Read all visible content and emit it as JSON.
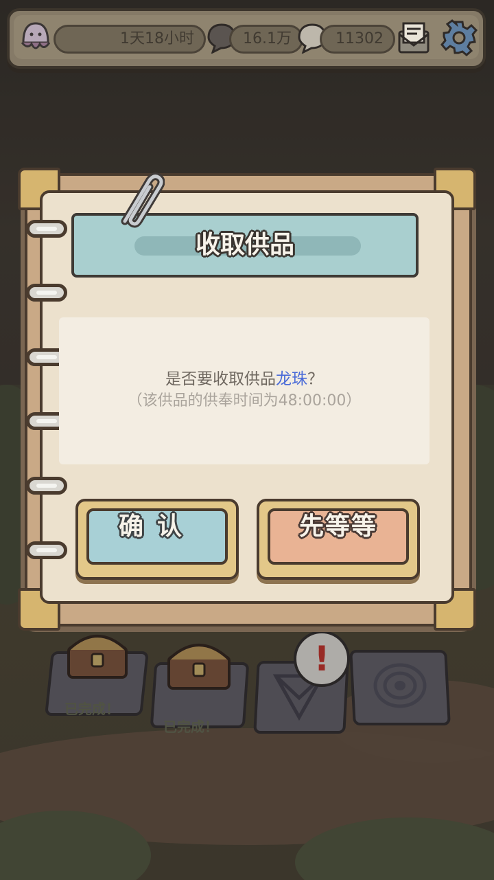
{
  "topbar": {
    "time_remaining": "1天18小时",
    "currency_1": "16.1万",
    "currency_2": "11302",
    "icons": [
      "jellyfish-avatar-icon",
      "speech-bubble-icon",
      "speech-bubble-icon",
      "mail-icon",
      "gear-icon"
    ]
  },
  "dialog": {
    "title": "收取供品",
    "question_prefix": "是否要收取供品",
    "item_name": "龙珠",
    "question_suffix": "？",
    "note": "（该供品的供奉时间为48:00:00）",
    "confirm_label": "确认",
    "wait_label": "先等等"
  },
  "altars": [
    {
      "status": "已完成！"
    },
    {
      "status": "已完成！"
    },
    {
      "status": "",
      "alert": "!"
    },
    {
      "status": ""
    }
  ],
  "colors": {
    "title_banner": "#a9cfcf",
    "confirm_button": "#a8d0d6",
    "wait_button": "#e9b394",
    "item_highlight": "#4a6bd8"
  }
}
